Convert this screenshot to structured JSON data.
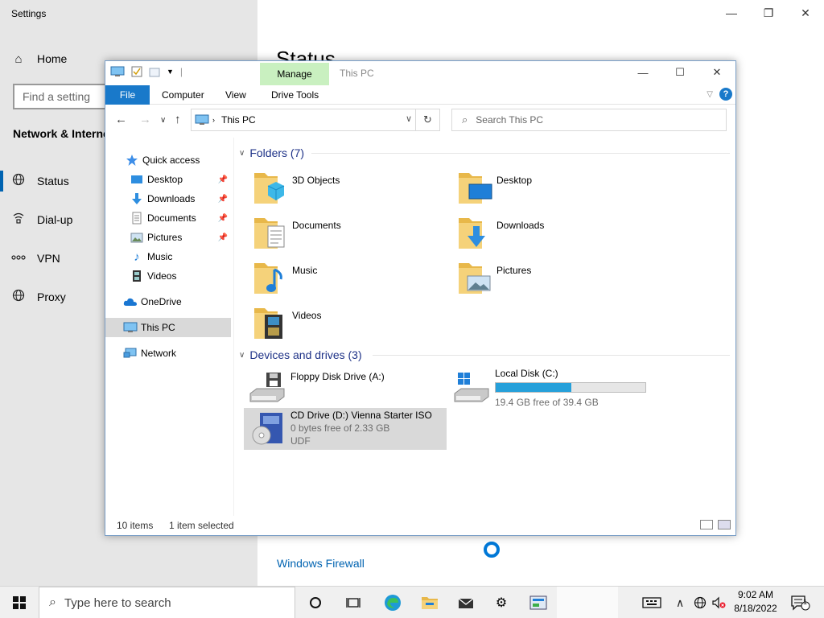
{
  "settings": {
    "window_title": "Settings",
    "home_label": "Home",
    "find_placeholder": "Find a setting",
    "section_label": "Network & Interne",
    "nav": [
      {
        "label": "Status",
        "icon": "globe-icon"
      },
      {
        "label": "Dial-up",
        "icon": "dialup-icon"
      },
      {
        "label": "VPN",
        "icon": "vpn-icon"
      },
      {
        "label": "Proxy",
        "icon": "globe-icon"
      }
    ],
    "page_heading": "Status",
    "firewall_link": "Windows Firewall"
  },
  "explorer": {
    "title": "This PC",
    "manage_tab": "Manage",
    "ribbon_tabs": [
      "File",
      "Computer",
      "View",
      "Drive Tools"
    ],
    "address": "This PC",
    "search_placeholder": "Search This PC",
    "sidebar": [
      {
        "label": "Quick access",
        "pinned": false
      },
      {
        "label": "Desktop",
        "pinned": true
      },
      {
        "label": "Downloads",
        "pinned": true
      },
      {
        "label": "Documents",
        "pinned": true
      },
      {
        "label": "Pictures",
        "pinned": true
      },
      {
        "label": "Music",
        "pinned": false
      },
      {
        "label": "Videos",
        "pinned": false
      },
      {
        "label": "OneDrive",
        "pinned": false
      },
      {
        "label": "This PC",
        "pinned": false,
        "selected": true
      },
      {
        "label": "Network",
        "pinned": false
      }
    ],
    "folders_header": "Folders (7)",
    "folders": [
      "3D Objects",
      "Desktop",
      "Documents",
      "Downloads",
      "Music",
      "Pictures",
      "Videos"
    ],
    "devices_header": "Devices and drives (3)",
    "drives": [
      {
        "name": "Floppy Disk Drive (A:)"
      },
      {
        "name": "Local Disk (C:)",
        "free": "19.4 GB free of 39.4 GB",
        "used_fraction": 0.508
      },
      {
        "name": "CD Drive (D:) Vienna Starter ISO",
        "free": "0 bytes free of 2.33 GB",
        "fs": "UDF",
        "selected": true
      }
    ],
    "status_items": "10 items",
    "status_selected": "1 item selected"
  },
  "taskbar": {
    "search_placeholder": "Type here to search",
    "time": "9:02 AM",
    "date": "8/18/2022",
    "notification_count": "1"
  },
  "colors": {
    "accent": "#0063b1",
    "file_tab": "#1979ca",
    "manage_tab": "#c9f0c0",
    "disk_bar": "#26a0da",
    "selection": "#d9d9d9"
  }
}
